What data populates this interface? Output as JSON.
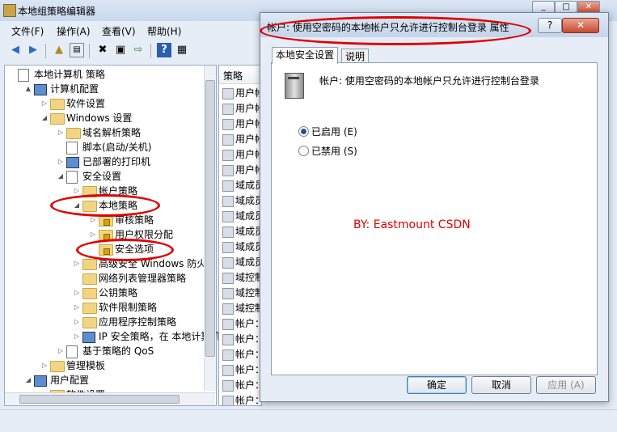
{
  "main_window": {
    "title": "本地组策略编辑器",
    "menu": [
      "文件(F)",
      "操作(A)",
      "查看(V)",
      "帮助(H)"
    ]
  },
  "tree": {
    "items": [
      {
        "label": "本地计算机 策略",
        "indent": 0,
        "arrow": "",
        "icon": "doc"
      },
      {
        "label": "计算机配置",
        "indent": 1,
        "arrow": "▲",
        "icon": "pc"
      },
      {
        "label": "软件设置",
        "indent": 2,
        "arrow": "▷",
        "icon": "folder"
      },
      {
        "label": "Windows 设置",
        "indent": 2,
        "arrow": "◢",
        "icon": "folder"
      },
      {
        "label": "域名解析策略",
        "indent": 3,
        "arrow": "▷",
        "icon": "folder"
      },
      {
        "label": "脚本(启动/关机)",
        "indent": 3,
        "arrow": "",
        "icon": "doc"
      },
      {
        "label": "已部署的打印机",
        "indent": 3,
        "arrow": "▷",
        "icon": "pc"
      },
      {
        "label": "安全设置",
        "indent": 3,
        "arrow": "◢",
        "icon": "doc"
      },
      {
        "label": "帐户策略",
        "indent": 4,
        "arrow": "▷",
        "icon": "folder"
      },
      {
        "label": "本地策略",
        "indent": 4,
        "arrow": "◢",
        "icon": "folder"
      },
      {
        "label": "审核策略",
        "indent": 5,
        "arrow": "▷",
        "icon": "lockfolder"
      },
      {
        "label": "用户权限分配",
        "indent": 5,
        "arrow": "▷",
        "icon": "lockfolder"
      },
      {
        "label": "安全选项",
        "indent": 5,
        "arrow": "",
        "icon": "lockfolder"
      },
      {
        "label": "高级安全 Windows 防火墙",
        "indent": 4,
        "arrow": "▷",
        "icon": "folder"
      },
      {
        "label": "网络列表管理器策略",
        "indent": 4,
        "arrow": "",
        "icon": "folder"
      },
      {
        "label": "公钥策略",
        "indent": 4,
        "arrow": "▷",
        "icon": "folder"
      },
      {
        "label": "软件限制策略",
        "indent": 4,
        "arrow": "▷",
        "icon": "folder"
      },
      {
        "label": "应用程序控制策略",
        "indent": 4,
        "arrow": "▷",
        "icon": "folder"
      },
      {
        "label": "IP 安全策略，在 本地计算机",
        "indent": 4,
        "arrow": "▷",
        "icon": "pc"
      },
      {
        "label": "基于策略的 QoS",
        "indent": 3,
        "arrow": "▷",
        "icon": "chart"
      },
      {
        "label": "管理模板",
        "indent": 2,
        "arrow": "▷",
        "icon": "folder"
      },
      {
        "label": "用户配置",
        "indent": 1,
        "arrow": "◢",
        "icon": "pc"
      },
      {
        "label": "软件设置",
        "indent": 2,
        "arrow": "▷",
        "icon": "folder"
      }
    ]
  },
  "policy_list": {
    "header": "策略",
    "rows": [
      "用户帐",
      "用户帐",
      "用户帐",
      "用户帐",
      "用户帐",
      "用户帐",
      "域成员",
      "域成员",
      "域成员",
      "域成员",
      "域成员",
      "域成员",
      "域控制",
      "域控制",
      "域控制",
      "帐户：",
      "帐户：",
      "帐户：",
      "帐户：",
      "帐户：",
      "帐户："
    ]
  },
  "dialog": {
    "title": "帐户: 使用空密码的本地帐户只允许进行控制台登录 属性",
    "help": "?",
    "close": "✕",
    "tabs": [
      "本地安全设置",
      "说明"
    ],
    "policy_desc": "帐户: 使用空密码的本地帐户只允许进行控制台登录",
    "options": [
      "已启用 (E)",
      "已禁用 (S)"
    ],
    "selected_option": 0,
    "buttons": {
      "ok": "确定",
      "cancel": "取消",
      "apply": "应用 (A)"
    }
  },
  "watermark": "BY: Eastmount CSDN",
  "colors": {
    "annotation": "#e00000",
    "watermark": "#e00000"
  }
}
